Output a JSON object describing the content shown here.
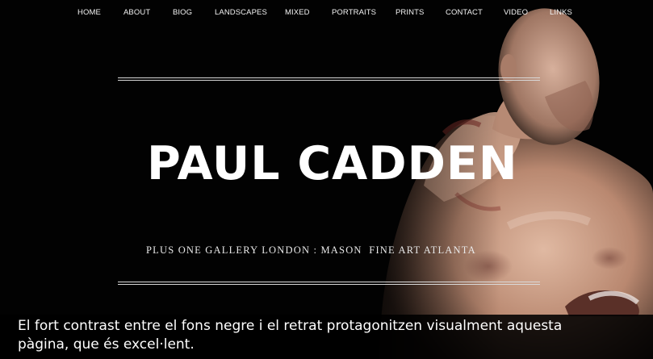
{
  "nav": {
    "items": [
      {
        "label": "HOME"
      },
      {
        "label": "ABOUT"
      },
      {
        "label": "BIOG"
      },
      {
        "label": "LANDSCAPES"
      },
      {
        "label": "MIXED"
      },
      {
        "label": "PORTRAITS"
      },
      {
        "label": "PRINTS"
      },
      {
        "label": "CONTACT"
      },
      {
        "label": "VIDEO"
      },
      {
        "label": "LINKS"
      }
    ]
  },
  "hero": {
    "title": "PAUL CADDEN",
    "subtitle": "PLUS ONE GALLERY LONDON : MASON  FINE ART ATLANTA"
  },
  "caption": {
    "text": "El fort contrast entre el fons negre i el retrat protagonitzen visualment aquesta pàgina, que és excel·lent."
  },
  "colors": {
    "background": "#000000",
    "text": "#ffffff",
    "skin": "#c99a82"
  }
}
